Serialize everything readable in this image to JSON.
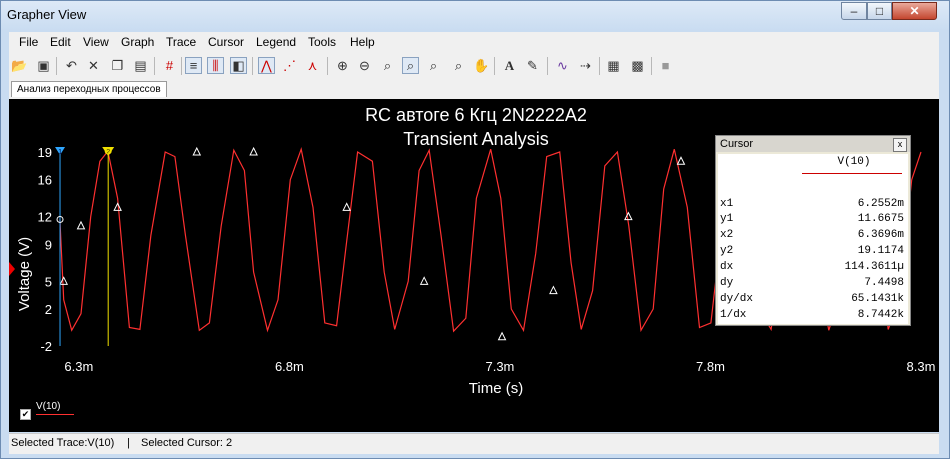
{
  "window": {
    "title": "Grapher View"
  },
  "menu": [
    "File",
    "Edit",
    "View",
    "Graph",
    "Trace",
    "Cursor",
    "Legend",
    "Tools",
    "Help"
  ],
  "tab": {
    "label": "Анализ переходных процессов"
  },
  "plot": {
    "title_line1": "RC автоге 6 Кгц 2N2222A2",
    "title_line2": "Transient Analysis",
    "background": "#000000",
    "trace_color": "#ff3030",
    "cursor1_color": "#2fa7ff",
    "cursor2_color": "#f0e000"
  },
  "cursor_panel": {
    "title": "Cursor",
    "close_label": "x",
    "column": "V(10)",
    "rows": [
      {
        "label": "x1",
        "value": "6.2552m"
      },
      {
        "label": "y1",
        "value": "11.6675"
      },
      {
        "label": "x2",
        "value": "6.3696m"
      },
      {
        "label": "y2",
        "value": "19.1174"
      },
      {
        "label": "dx",
        "value": "114.3611µ"
      },
      {
        "label": "dy",
        "value": "7.4498"
      },
      {
        "label": "dy/dx",
        "value": "65.1431k"
      },
      {
        "label": "1/dx",
        "value": "8.7442k"
      }
    ]
  },
  "legend": {
    "label": "V(10)"
  },
  "cursor_markers": {
    "c1": "1",
    "c2": "2"
  },
  "status": {
    "trace": "Selected Trace:V(10)",
    "separator": "|",
    "cursor": "Selected Cursor: 2"
  },
  "chart_data": {
    "type": "line",
    "xlabel": "Time (s)",
    "ylabel": "Voltage (V)",
    "x_ticks": [
      6.3,
      6.8,
      7.3,
      7.8,
      8.3
    ],
    "x_tick_labels": [
      "6.3m",
      "6.8m",
      "7.3m",
      "7.8m",
      "8.3m"
    ],
    "y_ticks": [
      19,
      16,
      12,
      9,
      5,
      2,
      -2
    ],
    "y_tick_labels": [
      "19",
      "16",
      "12",
      "9",
      "5",
      "2",
      "-2"
    ],
    "xlim": [
      6.2504,
      8.3
    ],
    "ylim": [
      -2,
      19
    ],
    "cursors": [
      6.2552,
      6.3696
    ],
    "series": [
      {
        "name": "V(10)",
        "x": [
          6.255,
          6.264,
          6.283,
          6.305,
          6.328,
          6.35,
          6.369,
          6.392,
          6.42,
          6.445,
          6.471,
          6.505,
          6.528,
          6.553,
          6.586,
          6.61,
          6.638,
          6.668,
          6.693,
          6.715,
          6.748,
          6.773,
          6.802,
          6.828,
          6.856,
          6.884,
          6.912,
          6.935,
          6.962,
          6.997,
          7.025,
          7.05,
          7.082,
          7.108,
          7.132,
          7.16,
          7.19,
          7.219,
          7.244,
          7.278,
          7.302,
          7.327,
          7.356,
          7.385,
          7.411,
          7.442,
          7.469,
          7.493,
          7.52,
          7.549,
          7.579,
          7.606,
          7.635,
          7.664,
          7.689,
          7.714,
          7.745,
          7.774,
          7.801,
          7.83,
          7.857,
          7.886,
          7.915,
          7.944,
          7.97,
          8.0,
          8.025,
          8.051,
          8.081,
          8.11,
          8.139,
          8.166,
          8.196,
          8.222,
          8.248,
          8.278,
          8.3
        ],
        "y": [
          11.7,
          3.0,
          -0.3,
          1.5,
          12.0,
          18.0,
          19.1,
          14.0,
          0.0,
          -0.2,
          10.0,
          19.0,
          18.5,
          10.0,
          -0.3,
          0.5,
          11.0,
          19.2,
          17.0,
          6.0,
          -0.3,
          3.0,
          16.0,
          19.3,
          13.0,
          0.5,
          0.2,
          9.0,
          19.0,
          18.0,
          6.0,
          -0.2,
          5.0,
          17.0,
          19.2,
          10.0,
          -0.4,
          1.0,
          14.0,
          19.3,
          14.0,
          2.0,
          -0.3,
          8.0,
          18.5,
          19.0,
          7.0,
          -0.2,
          4.0,
          17.5,
          19.0,
          11.0,
          -0.3,
          2.0,
          15.0,
          19.3,
          13.0,
          0.0,
          0.5,
          12.0,
          19.2,
          16.0,
          2.0,
          -0.2,
          8.0,
          18.5,
          18.5,
          7.0,
          -0.3,
          4.0,
          17.0,
          19.0,
          10.0,
          -0.2,
          3.0,
          16.0,
          19.0
        ],
        "markers_x": [
          6.264,
          6.305,
          6.392,
          6.58,
          6.715,
          6.936,
          7.12,
          7.305,
          7.427,
          7.605,
          7.73
        ],
        "markers_y": [
          5.0,
          11.0,
          13.0,
          19.0,
          19.0,
          13.0,
          5.0,
          -1.0,
          4.0,
          12.0,
          18.0
        ]
      }
    ]
  }
}
